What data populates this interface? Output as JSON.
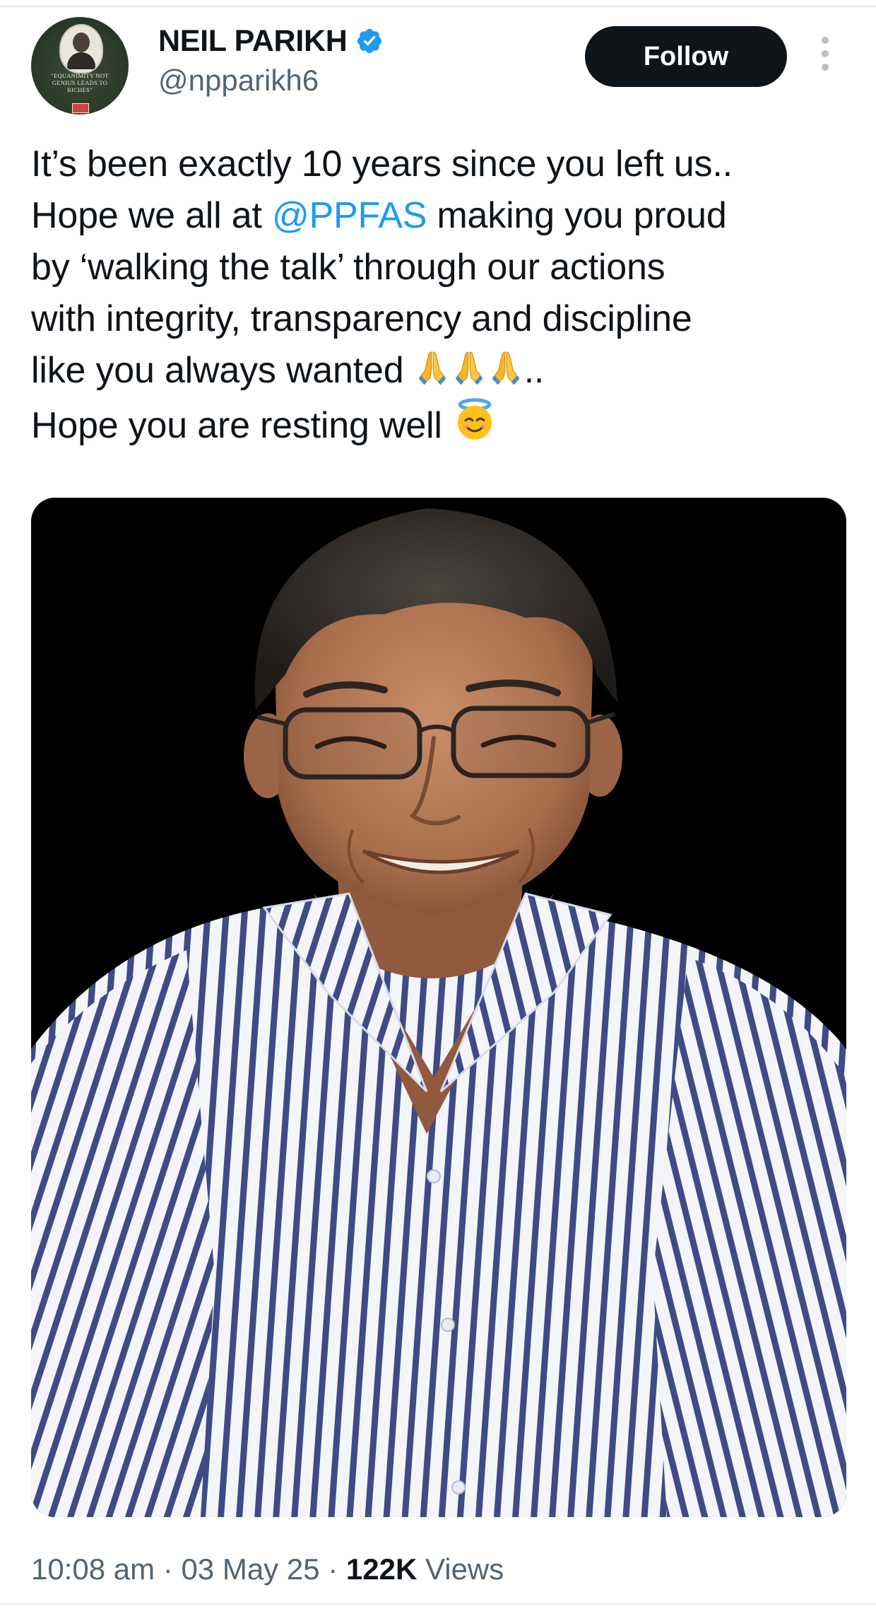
{
  "author": {
    "display_name": "NEIL PARIKH",
    "handle": "@npparikh6",
    "avatar_quote": "\"EQUANIMITY NOT GENIUS LEADS TO RICHES\"",
    "verified_color": "#1d9bf0"
  },
  "actions": {
    "follow_label": "Follow"
  },
  "tweet": {
    "line1": "It’s been exactly 10 years since you left us..",
    "line2_pre": "Hope we all at ",
    "mention": "@PPFAS",
    "line2_post": " making you proud",
    "line3": "by ‘walking the talk’ through our actions",
    "line4": "with integrity, transparency and discipline",
    "line5_pre": "like you always wanted ",
    "line5_post": "..",
    "line6": "Hope you are resting well "
  },
  "icons": {
    "folded_hands": "folded-hands-emoji",
    "halo_face": "smiling-face-with-halo-emoji",
    "verified": "verified-badge",
    "more": "more-vertical-dots"
  },
  "meta": {
    "time": "10:08 am",
    "separator": " · ",
    "date": "03 May 25",
    "views_count": "122K",
    "views_label": " Views"
  },
  "colors": {
    "link": "#1d9bf0",
    "text": "#0f1419",
    "secondary": "#536471",
    "follow_bg": "#0f1419"
  }
}
